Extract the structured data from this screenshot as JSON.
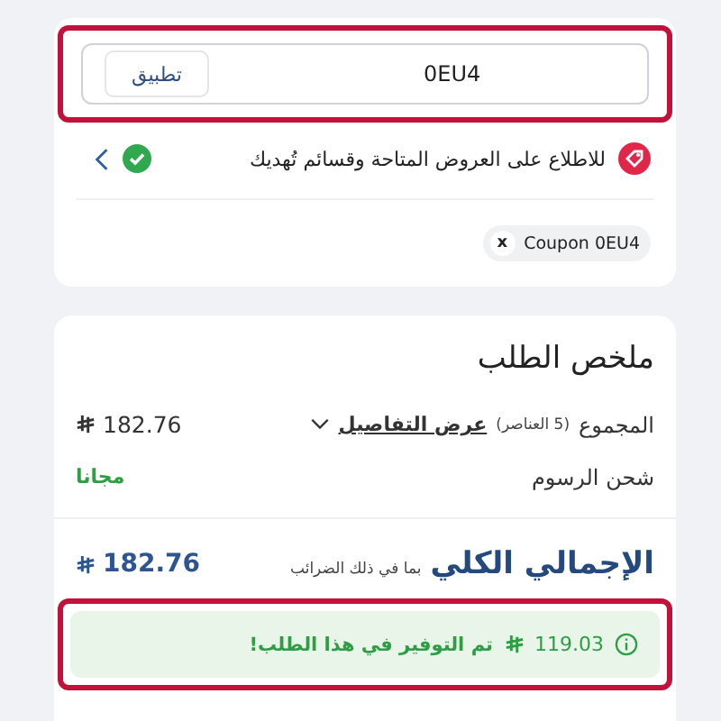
{
  "coupon_field": {
    "value": "0EU4",
    "apply_button": "تطبيق"
  },
  "offers_row": {
    "text": "للاطلاع على العروض المتاحة وقسائم تُهديك",
    "applied": true
  },
  "applied_coupons": [
    {
      "label": "Coupon 0EU4",
      "remove": "x"
    }
  ],
  "summary": {
    "title": "ملخص الطلب",
    "subtotal": {
      "label": "المجموع",
      "count": "(5 العناصر)",
      "details_link": "عرض التفاصيل",
      "expanded": false,
      "amount": "182.76"
    },
    "shipping": {
      "label": "شحن الرسوم",
      "value": "مجانا"
    },
    "total": {
      "label": "الإجمالي الكلي",
      "note": "بما في ذلك الضرائب",
      "amount": "182.76"
    },
    "savings": {
      "amount": "119.03",
      "message": "تم التوفير في هذا الطلب!"
    }
  }
}
